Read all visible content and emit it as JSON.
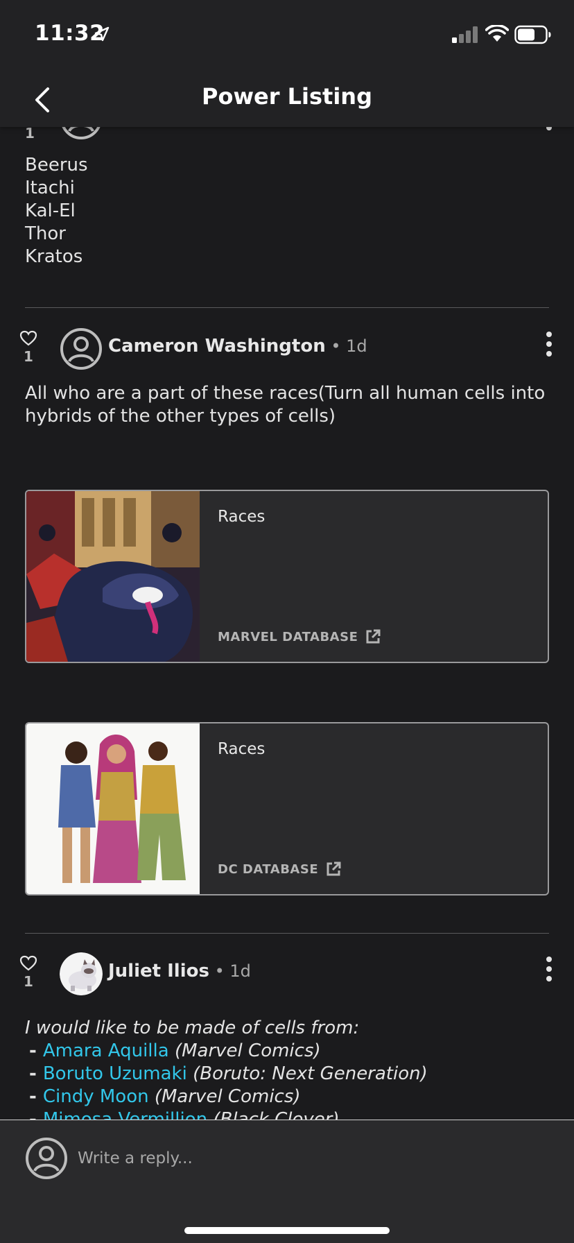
{
  "status_bar": {
    "time": "11:32"
  },
  "header": {
    "title": "Power Listing"
  },
  "previous_comment": {
    "likes": "1",
    "lines": [
      "Beerus",
      "Itachi",
      "Kal-El",
      "Thor",
      "Kratos"
    ]
  },
  "comments": [
    {
      "likes": "1",
      "author": "Cameron Washington",
      "meta": " • 1d",
      "text": "All who are a part of these races(Turn all human cells into hybrids of the other types of cells)",
      "cards": [
        {
          "title": "Races",
          "source": "MARVEL DATABASE"
        },
        {
          "title": "Races",
          "source": "DC DATABASE"
        }
      ]
    },
    {
      "likes": "1",
      "author": "Juliet Ilios",
      "meta": " • 1d",
      "intro": "I would like to be made of cells from:",
      "items": [
        {
          "dash": "- ",
          "name": "Amara Aquilla",
          "source": " (Marvel Comics)"
        },
        {
          "dash": "- ",
          "name": "Boruto Uzumaki",
          "source": " (Boruto: Next Generation)"
        },
        {
          "dash": "- ",
          "name": "Cindy Moon",
          "source": " (Marvel Comics)"
        },
        {
          "dash": "- ",
          "name": "Mimosa Vermillion",
          "source": " (Black Clover)"
        }
      ]
    }
  ],
  "reply": {
    "placeholder": "Write a reply..."
  },
  "colors": {
    "background": "#1b1b1d",
    "link": "#32c7ea",
    "card": "#2a2a2c"
  }
}
